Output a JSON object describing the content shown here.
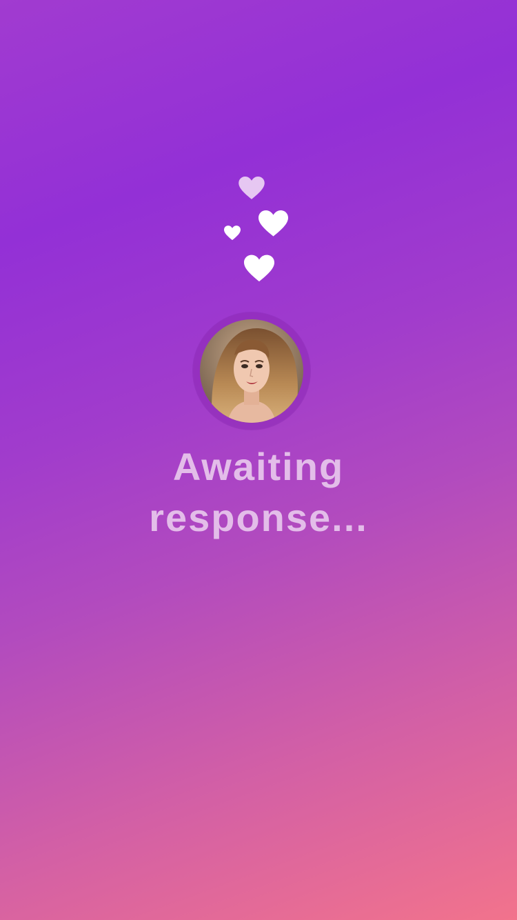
{
  "screen": {
    "status_line_1": "Awaiting",
    "status_line_2": "response..."
  },
  "icons": {
    "hearts": [
      "heart-icon",
      "heart-icon",
      "heart-icon",
      "heart-icon"
    ]
  },
  "colors": {
    "gradient_top": "#9330d6",
    "gradient_bottom": "#f2738c",
    "text": "#e3bde9",
    "heart_faded": "#e6c7f2",
    "heart": "#ffffff"
  }
}
